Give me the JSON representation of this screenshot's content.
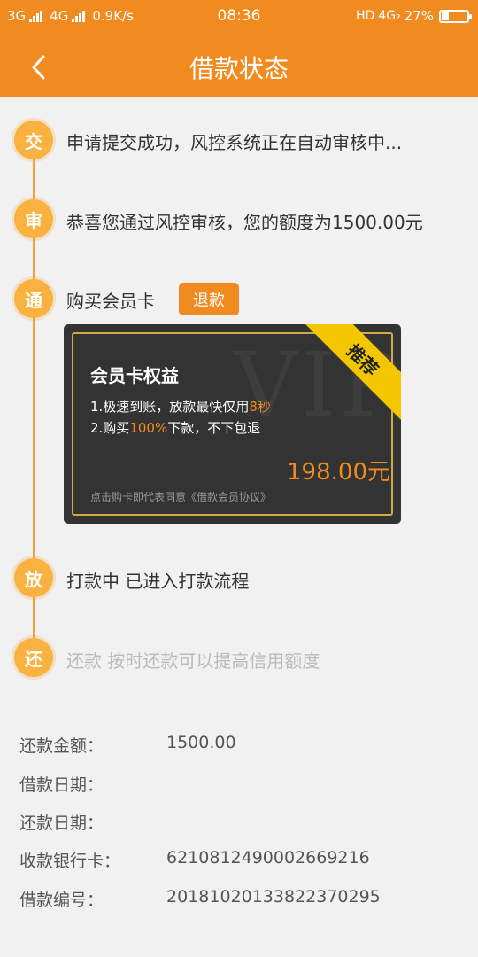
{
  "status_bar": {
    "net1": "3G",
    "net2": "4G",
    "speed": "0.9K/s",
    "time": "08:36",
    "hd": "HD",
    "net3": "4G₂",
    "battery": "27%",
    "battery_level": 0.27
  },
  "header": {
    "title": "借款状态",
    "back_icon": "chevron-left-icon"
  },
  "colors": {
    "brand": "#f18b1f",
    "circle": "#f9b140",
    "ribbon": "#f3c600",
    "card": "#333333"
  },
  "steps": [
    {
      "icon": "交",
      "text": "申请提交成功，风控系统正在自动审核中..."
    },
    {
      "icon": "审",
      "text": "恭喜您通过风控审核，您的额度为1500.00元"
    },
    {
      "icon": "通",
      "text": "购买会员卡"
    },
    {
      "icon": "放",
      "text": "打款中 已进入打款流程"
    },
    {
      "icon": "还",
      "text": "还款 按时还款可以提高信用额度"
    }
  ],
  "refund_button": "退款",
  "card": {
    "watermark": "VIP",
    "ribbon": "推荐",
    "title": "会员卡权益",
    "benefit1_pre": "1.极速到账，放款最快仅用",
    "benefit1_hl": "8秒",
    "benefit2_pre": "2.购买",
    "benefit2_hl": "100%",
    "benefit2_post": "下款，不下包退",
    "price": "198.00元",
    "agreement": "点击购卡即代表同意《借款会员协议》"
  },
  "info": [
    {
      "label": "还款金额：",
      "value": "1500.00"
    },
    {
      "label": "借款日期：",
      "value": ""
    },
    {
      "label": "还款日期：",
      "value": ""
    },
    {
      "label": "收款银行卡：",
      "value": "6210812490002669216"
    },
    {
      "label": "借款编号：",
      "value": "20181020133822370295"
    }
  ]
}
